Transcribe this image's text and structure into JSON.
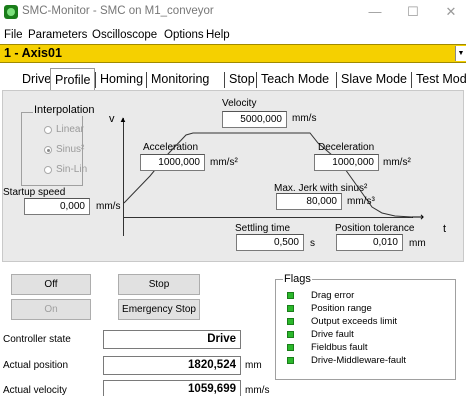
{
  "window": {
    "title": "SMC-Monitor - SMC on M1_conveyor",
    "minimize": "—",
    "maximize": "☐",
    "close": "✕"
  },
  "menu": [
    "File",
    "Parameters",
    "Oscilloscope",
    "Options",
    "Help"
  ],
  "axis": {
    "selected": "1 - Axis01",
    "dropdown_icon": "▼"
  },
  "tabs": [
    "Drive",
    "Profile",
    "Homing",
    "Monitoring",
    "Stop",
    "Teach Mode",
    "Slave Mode",
    "Test Mode"
  ],
  "active_tab": "Profile",
  "profile": {
    "interpolation": {
      "title": "Interpolation",
      "options": [
        "Linear",
        "Sinus²",
        "Sin-Lin"
      ],
      "selected": "Sinus²"
    },
    "y_axis_label": "v",
    "x_axis_label": "t",
    "velocity": {
      "label": "Velocity",
      "value": "5000,000",
      "unit": "mm/s"
    },
    "acceleration": {
      "label": "Acceleration",
      "value": "1000,000",
      "unit": "mm/s²"
    },
    "deceleration": {
      "label": "Deceleration",
      "value": "1000,000",
      "unit": "mm/s²"
    },
    "startup_speed": {
      "label": "Startup speed",
      "value": "0,000",
      "unit": "mm/s"
    },
    "max_jerk": {
      "label": "Max. Jerk with sinus²",
      "value": "80,000",
      "unit": "mm/s³"
    },
    "settling_time": {
      "label": "Settling time",
      "value": "0,500",
      "unit": "s"
    },
    "position_tolerance": {
      "label": "Position tolerance",
      "value": "0,010",
      "unit": "mm"
    }
  },
  "controls": {
    "off": "Off",
    "on": "On",
    "stop": "Stop",
    "emergency_stop": "Emergency Stop"
  },
  "status": {
    "controller_state": {
      "label": "Controller state",
      "value": "Drive"
    },
    "actual_position": {
      "label": "Actual position",
      "value": "1820,524",
      "unit": "mm"
    },
    "actual_velocity": {
      "label": "Actual velocity",
      "value": "1059,699",
      "unit": "mm/s"
    }
  },
  "flags": {
    "title": "Flags",
    "led_color": "#2bb82b",
    "items": [
      "Drag error",
      "Position range",
      "Output exceeds limit",
      "Drive fault",
      "Fieldbus fault",
      "Drive-Middleware-fault"
    ]
  },
  "colors": {
    "axis_bar": "#f5d000",
    "panel": "#eaeaea"
  }
}
